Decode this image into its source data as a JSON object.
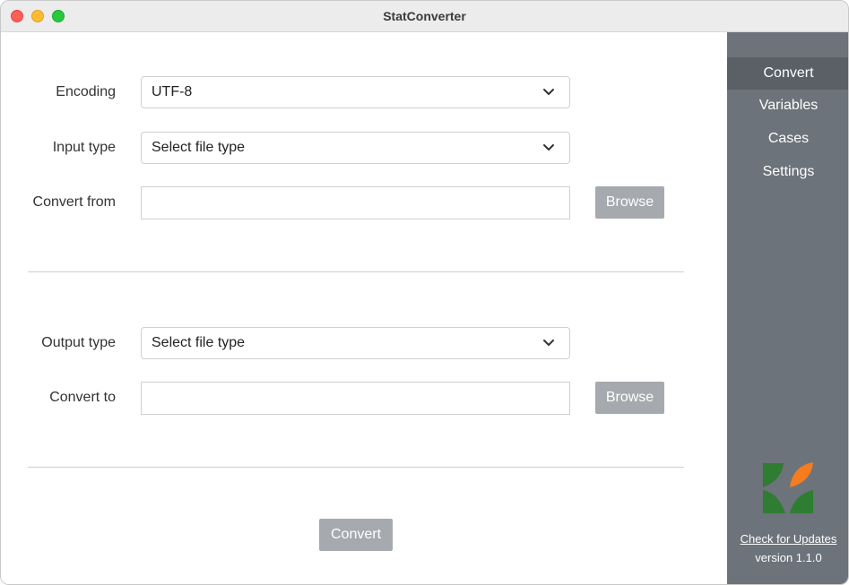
{
  "window": {
    "title": "StatConverter"
  },
  "form": {
    "encoding": {
      "label": "Encoding",
      "value": "UTF-8"
    },
    "input_type": {
      "label": "Input type",
      "value": "Select file type"
    },
    "convert_from": {
      "label": "Convert from",
      "value": "",
      "button": "Browse"
    },
    "output_type": {
      "label": "Output type",
      "value": "Select file type"
    },
    "convert_to": {
      "label": "Convert to",
      "value": "",
      "button": "Browse"
    },
    "convert_button": "Convert"
  },
  "sidebar": {
    "items": [
      {
        "label": "Convert",
        "active": true
      },
      {
        "label": "Variables",
        "active": false
      },
      {
        "label": "Cases",
        "active": false
      },
      {
        "label": "Settings",
        "active": false
      }
    ],
    "check_updates": "Check for Updates",
    "version": "version 1.1.0"
  },
  "colors": {
    "sidebar_bg": "#6c737a",
    "sidebar_active": "#5a6066",
    "button_bg": "#a6aaae",
    "logo_green": "#2e7d32",
    "logo_orange": "#f57c1f"
  }
}
